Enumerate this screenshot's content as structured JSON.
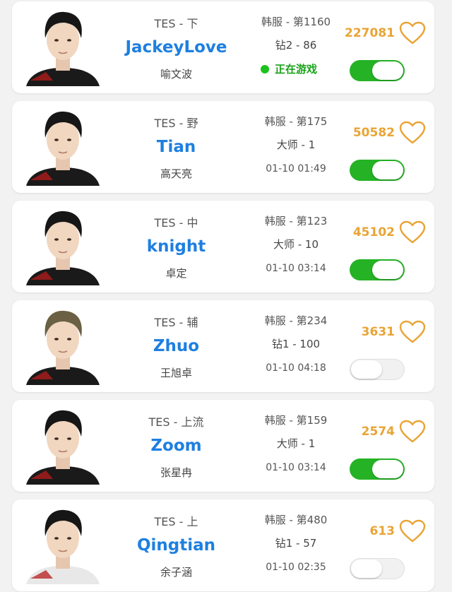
{
  "colors": {
    "name_blue": "#1e7fe0",
    "likes_orange": "#e9a435",
    "toggle_on": "#25b225",
    "online_green": "#1cc21c"
  },
  "players": [
    {
      "team_pos": "TES - 下",
      "id": "JackeyLove",
      "real_name": "喻文波",
      "server": "韩服 - 第1160",
      "tier": "钻2 - 86",
      "status": "正在游戏",
      "likes": "227081",
      "toggle_on": true,
      "jersey": "#1a1a1a",
      "avatar_icon": "player-photo"
    },
    {
      "team_pos": "TES - 野",
      "id": "Tian",
      "real_name": "高天亮",
      "server": "韩服 - 第175",
      "tier": "大师 - 1",
      "time": "01-10 01:49",
      "likes": "50582",
      "toggle_on": true,
      "jersey": "#1a1a1a",
      "avatar_icon": "player-photo"
    },
    {
      "team_pos": "TES - 中",
      "id": "knight",
      "real_name": "卓定",
      "server": "韩服 - 第123",
      "tier": "大师 - 10",
      "time": "01-10 03:14",
      "likes": "45102",
      "toggle_on": true,
      "jersey": "#1a1a1a",
      "avatar_icon": "player-photo"
    },
    {
      "team_pos": "TES - 辅",
      "id": "Zhuo",
      "real_name": "王旭卓",
      "server": "韩服 - 第234",
      "tier": "钻1 - 100",
      "time": "01-10 04:18",
      "likes": "3631",
      "toggle_on": false,
      "jersey": "#1a1a1a",
      "avatar_icon": "player-photo"
    },
    {
      "team_pos": "TES - 上流",
      "id": "Zoom",
      "real_name": "张星冉",
      "server": "韩服 - 第159",
      "tier": "大师 - 1",
      "time": "01-10 03:14",
      "likes": "2574",
      "toggle_on": true,
      "jersey": "#1a1a1a",
      "avatar_icon": "player-photo"
    },
    {
      "team_pos": "TES - 上",
      "id": "Qingtian",
      "real_name": "余子涵",
      "server": "韩服 - 第480",
      "tier": "钻1 - 57",
      "time": "01-10 02:35",
      "likes": "613",
      "toggle_on": false,
      "jersey": "#e8e8e8",
      "avatar_icon": "player-photo"
    }
  ]
}
